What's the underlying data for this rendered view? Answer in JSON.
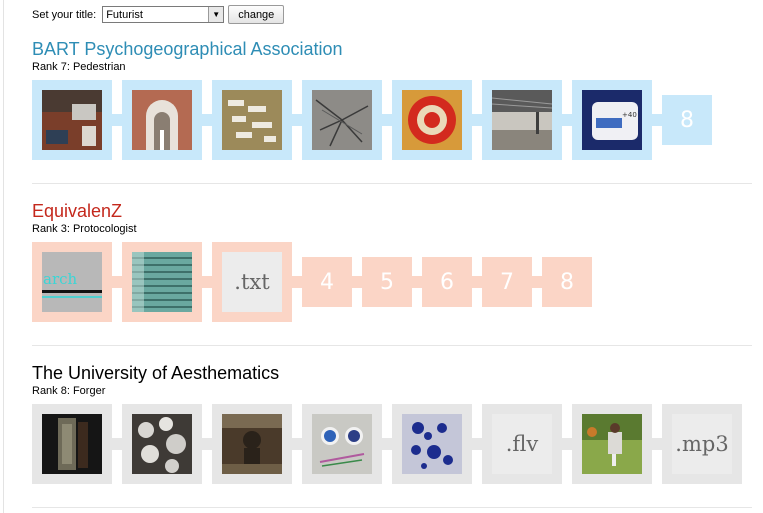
{
  "title_setting": {
    "label": "Set your title:",
    "selected": "Futurist",
    "button": "change"
  },
  "groups": [
    {
      "name": "BART Psychogeographical Association",
      "rank": "Rank 7: Pedestrian",
      "theme_color": "#2e8db5",
      "tiles": [
        {
          "kind": "photo",
          "icon": "desk-photo"
        },
        {
          "kind": "photo",
          "icon": "archway-photo"
        },
        {
          "kind": "photo",
          "icon": "notes-on-table-photo"
        },
        {
          "kind": "photo",
          "icon": "transit-map-photo"
        },
        {
          "kind": "photo",
          "icon": "target-logo-photo"
        },
        {
          "kind": "photo",
          "icon": "station-platform-photo"
        },
        {
          "kind": "photo",
          "icon": "bart-ticket-photo",
          "caption": "+40"
        },
        {
          "kind": "number",
          "text": "8"
        }
      ]
    },
    {
      "name": "EquivalenZ",
      "rank": "Rank 3: Protocologist",
      "theme_color": "#c4281c",
      "tiles": [
        {
          "kind": "photo",
          "icon": "search-text-photo",
          "caption": "arch"
        },
        {
          "kind": "photo",
          "icon": "window-blinds-photo"
        },
        {
          "kind": "file",
          "text": ".txt"
        },
        {
          "kind": "number",
          "text": "4"
        },
        {
          "kind": "number",
          "text": "5"
        },
        {
          "kind": "number",
          "text": "6"
        },
        {
          "kind": "number",
          "text": "7"
        },
        {
          "kind": "number",
          "text": "8"
        }
      ]
    },
    {
      "name": "The University of Aesthematics",
      "rank": "Rank 8: Forger",
      "theme_color": "#000000",
      "tiles": [
        {
          "kind": "photo",
          "icon": "book-spine-photo"
        },
        {
          "kind": "photo",
          "icon": "snowy-ground-photo"
        },
        {
          "kind": "photo",
          "icon": "sculpture-photo"
        },
        {
          "kind": "photo",
          "icon": "paint-cups-photo"
        },
        {
          "kind": "photo",
          "icon": "blue-ink-splatter-photo"
        },
        {
          "kind": "file",
          "text": ".flv"
        },
        {
          "kind": "photo",
          "icon": "people-on-lawn-photo"
        },
        {
          "kind": "file",
          "text": ".mp3"
        }
      ]
    }
  ]
}
